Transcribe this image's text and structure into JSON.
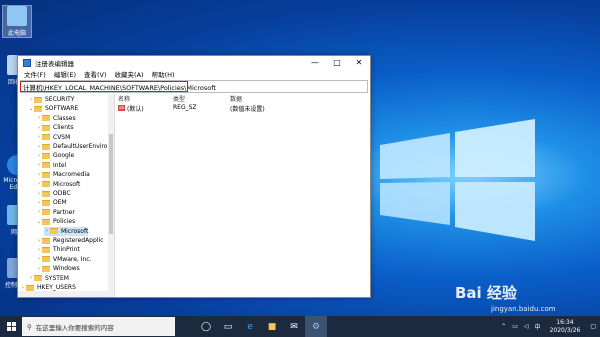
{
  "desktop": {
    "icons": [
      {
        "label": "此电脑"
      },
      {
        "label": "回收站"
      },
      {
        "label": "Microsoft Edge"
      },
      {
        "label": "网络"
      },
      {
        "label": "控制面板"
      }
    ]
  },
  "window": {
    "title": "注册表编辑器",
    "controls": {
      "min": "—",
      "max": "□",
      "close": "✕"
    },
    "menu": [
      "文件(F)",
      "编辑(E)",
      "查看(V)",
      "收藏夹(A)",
      "帮助(H)"
    ],
    "address": "计算机\\HKEY_LOCAL_MACHINE\\SOFTWARE\\Policies\\Microsoft",
    "tree": [
      {
        "label": "SECURITY",
        "arrow": "›"
      },
      {
        "label": "SOFTWARE",
        "arrow": "⌄"
      },
      {
        "label": "Classes",
        "arrow": "›"
      },
      {
        "label": "Clients",
        "arrow": "›"
      },
      {
        "label": "CVSM",
        "arrow": "›"
      },
      {
        "label": "DefaultUserEnviro",
        "arrow": "›"
      },
      {
        "label": "Google",
        "arrow": "›"
      },
      {
        "label": "Intel",
        "arrow": "›"
      },
      {
        "label": "Macromedia",
        "arrow": "›"
      },
      {
        "label": "Microsoft",
        "arrow": "›"
      },
      {
        "label": "ODBC",
        "arrow": "›"
      },
      {
        "label": "OEM",
        "arrow": "›"
      },
      {
        "label": "Partner",
        "arrow": "›"
      },
      {
        "label": "Policies",
        "arrow": "⌄"
      },
      {
        "label": "Microsoft",
        "arrow": "›",
        "selected": true
      },
      {
        "label": "RegisteredApplic",
        "arrow": "›"
      },
      {
        "label": "ThinPrint",
        "arrow": "›"
      },
      {
        "label": "VMware, Inc.",
        "arrow": "›"
      },
      {
        "label": "Windows",
        "arrow": "›"
      },
      {
        "label": "SYSTEM",
        "arrow": "›"
      },
      {
        "label": "HKEY_USERS",
        "arrow": "›"
      }
    ],
    "list": {
      "headers": {
        "name": "名称",
        "type": "类型",
        "data": "数据"
      },
      "rows": [
        {
          "name": "(默认)",
          "type": "REG_SZ",
          "data": "(数值未设置)"
        }
      ]
    }
  },
  "taskbar": {
    "search_placeholder": "在这里输入你要搜索的内容",
    "time": "16:34",
    "date": "2020/3/26"
  },
  "watermark": {
    "brand": "Bai 经验",
    "url": "jingyan.baidu.com"
  }
}
